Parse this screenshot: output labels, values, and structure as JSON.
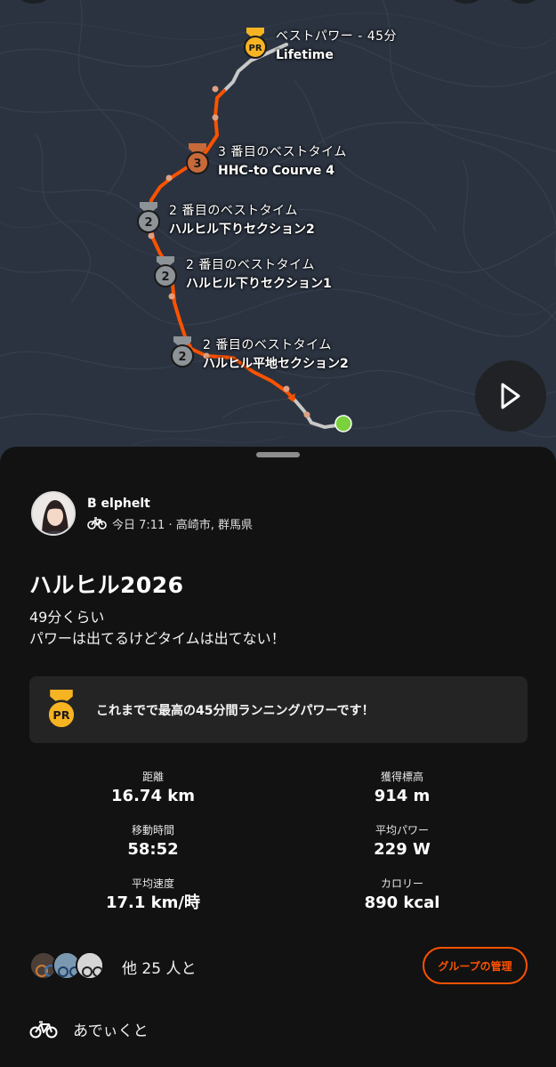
{
  "map": {
    "milestones": [
      {
        "rank": "PR",
        "line1": "ベストパワー - 45分",
        "line2": "Lifetime",
        "medal_color": "#f6b322"
      },
      {
        "rank": "3",
        "line1": "3 番目のベストタイム",
        "line2": "HHC-to Courve 4",
        "medal_color": "#c76a3a"
      },
      {
        "rank": "2",
        "line1": "2 番目のベストタイム",
        "line2": "ハルヒル下りセクション2",
        "medal_color": "#8e9398"
      },
      {
        "rank": "2",
        "line1": "2 番目のベストタイム",
        "line2": "ハルヒル下りセクション1",
        "medal_color": "#8e9398"
      },
      {
        "rank": "2",
        "line1": "2 番目のベストタイム",
        "line2": "ハルヒル平地セクション2",
        "medal_color": "#8e9398"
      }
    ],
    "route_color": "#fc5200",
    "start_marker_color": "#7ad13c",
    "play_icon": "play-icon"
  },
  "athlete": {
    "name": "B elphelt",
    "activity_icon": "bike-icon",
    "subtitle": "今日 7:11 · 高崎市, 群馬県"
  },
  "activity": {
    "title": "ハルヒル2026",
    "description_lines": [
      "49分くらい",
      "パワーは出てるけどタイムは出てない！"
    ]
  },
  "pr_card": {
    "rank": "PR",
    "text": "これまでで最高の45分間ランニングパワーです！"
  },
  "stats": [
    {
      "label": "距離",
      "value": "16.74 km"
    },
    {
      "label": "獲得標高",
      "value": "914 m"
    },
    {
      "label": "移動時間",
      "value": "58:52"
    },
    {
      "label": "平均パワー",
      "value": "229 W"
    },
    {
      "label": "平均速度",
      "value": "17.1 km/時"
    },
    {
      "label": "カロリー",
      "value": "890 kcal"
    }
  ],
  "group": {
    "text": "他 25 人と",
    "manage_label": "グループの管理"
  },
  "gear": {
    "icon": "bike-icon",
    "name": "あでぃくと"
  },
  "colors": {
    "accent": "#fc5200",
    "sheet_bg": "#121212",
    "card_bg": "#242424",
    "map_bg": "#2b3340"
  }
}
